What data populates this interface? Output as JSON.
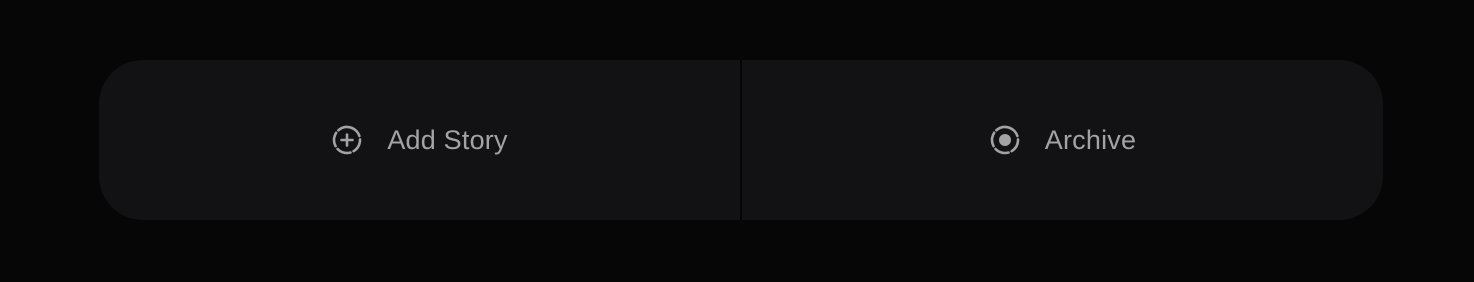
{
  "actions": {
    "add_story": {
      "label": "Add Story",
      "icon": "add-circle-dashed-icon"
    },
    "archive": {
      "label": "Archive",
      "icon": "archive-circle-dashed-icon"
    }
  },
  "colors": {
    "background": "#060606",
    "bar": "#121214",
    "text": "#a3a3a6",
    "icon": "#a3a3a6"
  }
}
